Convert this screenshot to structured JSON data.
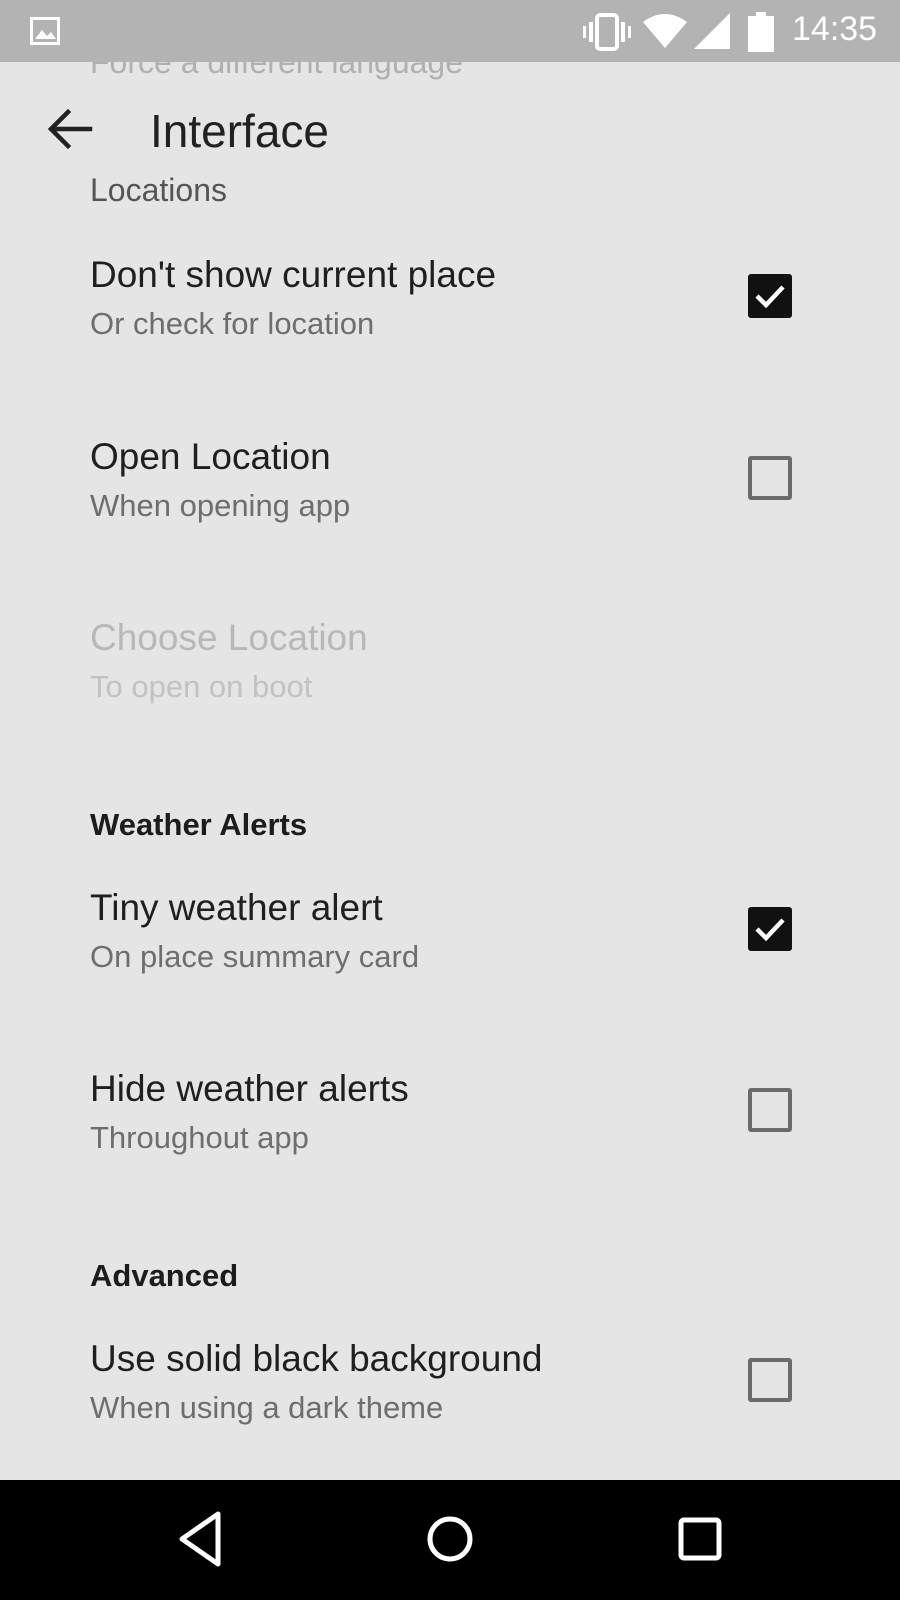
{
  "status_bar": {
    "time": "14:35",
    "icons": [
      "image-icon",
      "vibrate-icon",
      "wifi-icon",
      "signal-icon",
      "battery-icon"
    ]
  },
  "toolbar": {
    "title": "Interface",
    "back_icon": "back-arrow-icon"
  },
  "scrolled_hint": "Force a different language",
  "section_locations": "Locations",
  "prefs": {
    "current_place": {
      "title": "Don't show current place",
      "summary": "Or check for location",
      "checked": true
    },
    "open_location": {
      "title": "Open Location",
      "summary": "When opening app",
      "checked": false
    },
    "choose_location": {
      "title": "Choose Location",
      "summary": "To open on boot",
      "enabled": false
    },
    "tiny_alert": {
      "title": "Tiny weather alert",
      "summary": "On place summary card",
      "checked": true
    },
    "hide_alerts": {
      "title": "Hide weather alerts",
      "summary": "Throughout app",
      "checked": false
    },
    "solid_black": {
      "title": "Use solid black background",
      "summary": "When using a dark theme",
      "checked": false
    }
  },
  "section_weather_alerts": "Weather Alerts",
  "section_advanced": "Advanced",
  "nav_bar": {
    "icons": [
      "back-triangle-icon",
      "home-circle-icon",
      "recents-square-icon"
    ]
  },
  "colors": {
    "background": "#e5e5e5",
    "status_bar": "#b3b3b3",
    "checkbox_checked": "#111111"
  }
}
